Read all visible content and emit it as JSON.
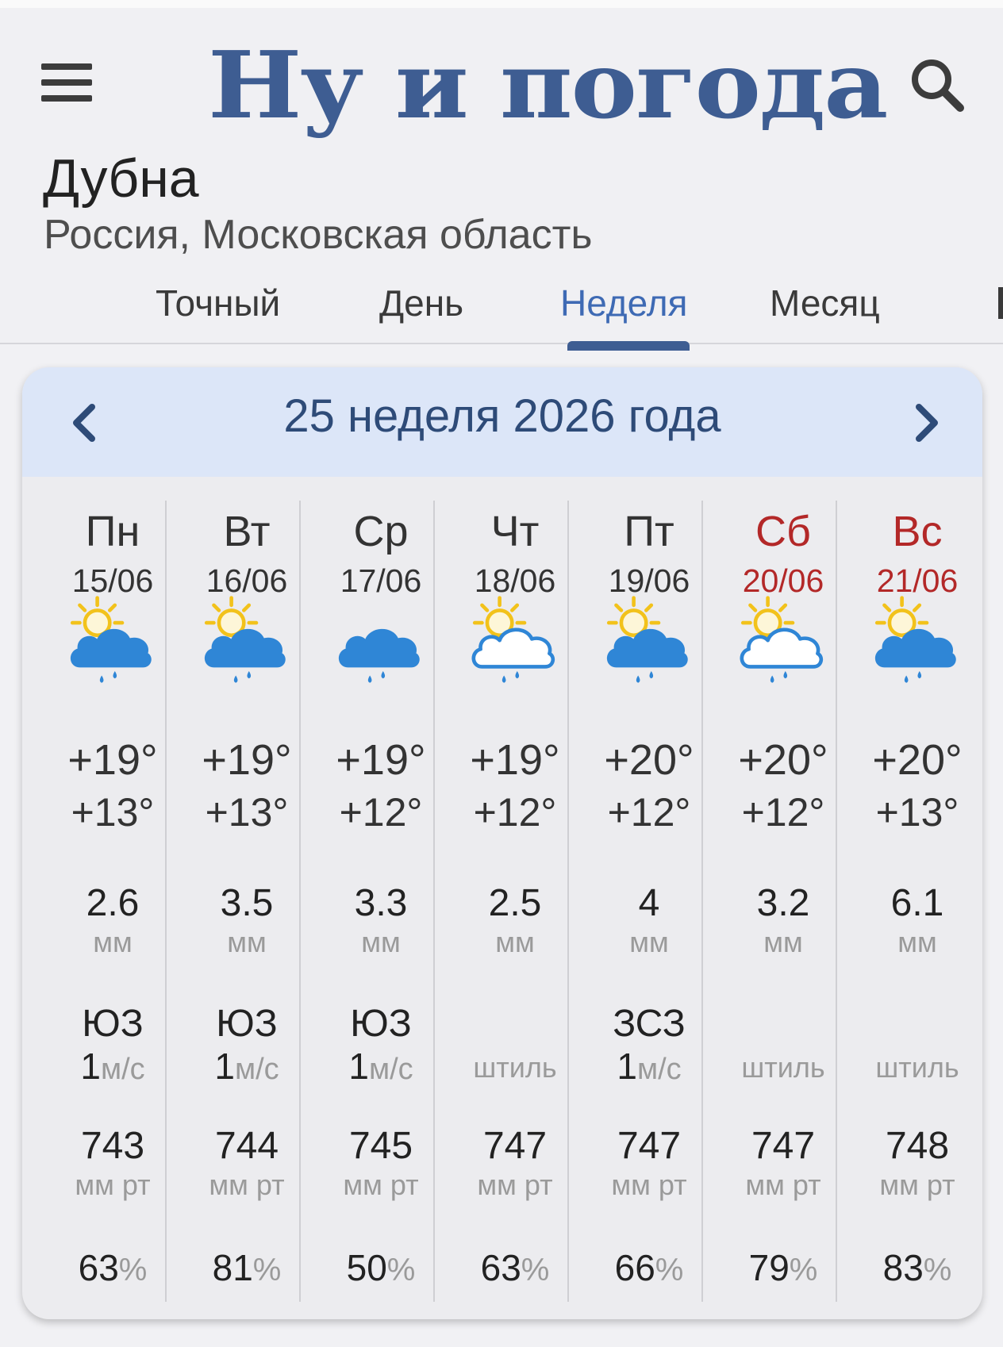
{
  "header": {
    "logo": "Ну и погода",
    "menu_icon": "hamburger-menu-icon",
    "search_icon": "search-icon"
  },
  "location": {
    "city": "Дубна",
    "region": "Россия, Московская область"
  },
  "tabs": [
    {
      "label": "Точный",
      "active": false
    },
    {
      "label": "День",
      "active": false
    },
    {
      "label": "Неделя",
      "active": true
    },
    {
      "label": "Месяц",
      "active": false
    }
  ],
  "week": {
    "title": "25 неделя 2026 года",
    "prev_icon": "chevron-left-icon",
    "next_icon": "chevron-right-icon"
  },
  "units": {
    "precip": "мм",
    "wind_speed": "м/с",
    "pressure": "мм рт",
    "humidity": "%",
    "calm": "штиль"
  },
  "colors": {
    "accent": "#3e6ab4",
    "logo": "#3e5d92",
    "weekend": "#b32828",
    "rain_cloud": "#2f86d6",
    "sun": "#f2c21b"
  },
  "days": [
    {
      "name": "Пн",
      "date": "15/06",
      "weekend": false,
      "icon": "sun-cloud-rain-icon",
      "icon_style": "filled",
      "t_max": "+19°",
      "t_min": "+13°",
      "precip": "2.6",
      "wind_dir": "ЮЗ",
      "wind_speed": "1",
      "pressure": "743",
      "humidity": "63"
    },
    {
      "name": "Вт",
      "date": "16/06",
      "weekend": false,
      "icon": "sun-cloud-rain-icon",
      "icon_style": "filled",
      "t_max": "+19°",
      "t_min": "+13°",
      "precip": "3.5",
      "wind_dir": "ЮЗ",
      "wind_speed": "1",
      "pressure": "744",
      "humidity": "81"
    },
    {
      "name": "Ср",
      "date": "17/06",
      "weekend": false,
      "icon": "cloud-rain-icon",
      "icon_style": "filled",
      "t_max": "+19°",
      "t_min": "+12°",
      "precip": "3.3",
      "wind_dir": "ЮЗ",
      "wind_speed": "1",
      "pressure": "745",
      "humidity": "50"
    },
    {
      "name": "Чт",
      "date": "18/06",
      "weekend": false,
      "icon": "sun-cloud-rain-icon",
      "icon_style": "outline",
      "t_max": "+19°",
      "t_min": "+12°",
      "precip": "2.5",
      "wind_dir": "",
      "wind_speed": "",
      "pressure": "747",
      "humidity": "63"
    },
    {
      "name": "Пт",
      "date": "19/06",
      "weekend": false,
      "icon": "sun-cloud-rain-icon",
      "icon_style": "filled",
      "t_max": "+20°",
      "t_min": "+12°",
      "precip": "4",
      "wind_dir": "ЗСЗ",
      "wind_speed": "1",
      "pressure": "747",
      "humidity": "66"
    },
    {
      "name": "Сб",
      "date": "20/06",
      "weekend": true,
      "icon": "sun-cloud-rain-icon",
      "icon_style": "outline",
      "t_max": "+20°",
      "t_min": "+12°",
      "precip": "3.2",
      "wind_dir": "",
      "wind_speed": "",
      "pressure": "747",
      "humidity": "79"
    },
    {
      "name": "Вс",
      "date": "21/06",
      "weekend": true,
      "icon": "sun-cloud-rain-icon",
      "icon_style": "filled",
      "t_max": "+20°",
      "t_min": "+13°",
      "precip": "6.1",
      "wind_dir": "",
      "wind_speed": "",
      "pressure": "748",
      "humidity": "83"
    }
  ]
}
